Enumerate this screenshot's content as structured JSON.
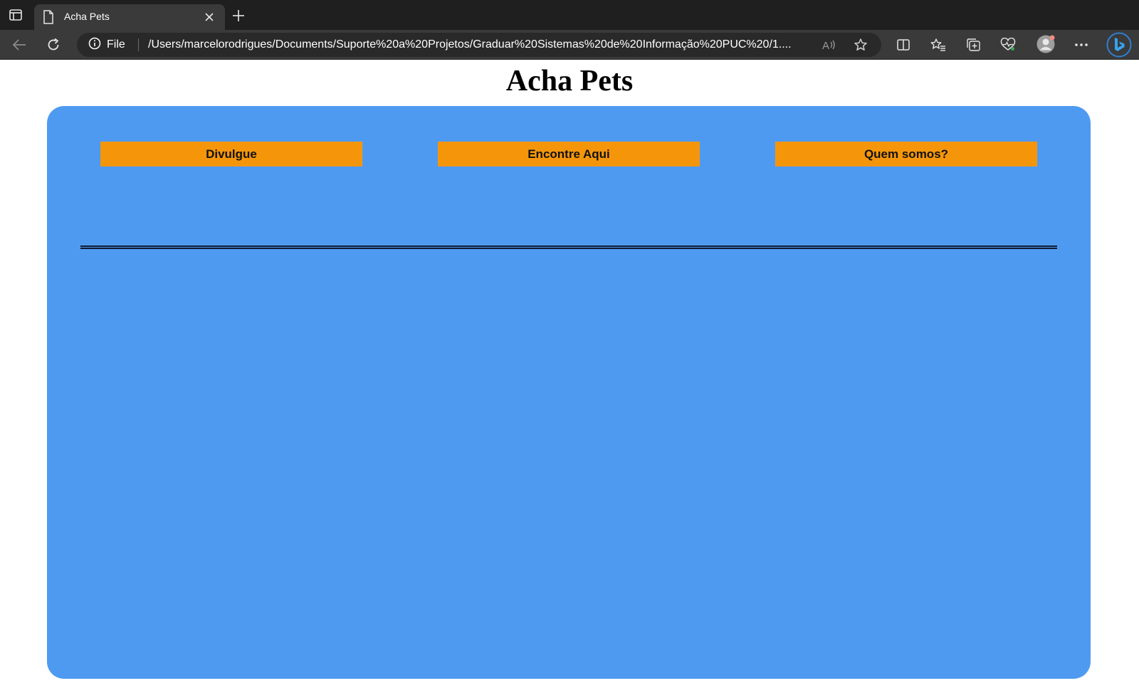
{
  "browser": {
    "tab": {
      "title": "Acha Pets"
    },
    "address_bar": {
      "site_info_label": "File",
      "url": "/Users/marcelorodrigues/Documents/Suporte%20a%20Projetos/Graduar%20Sistemas%20de%20Informação%20PUC%20/1...."
    },
    "icons": {
      "tab_actions": "tab-actions-icon",
      "tab_page": "document-icon",
      "tab_close": "close-icon",
      "new_tab": "plus-icon",
      "back": "back-arrow-icon",
      "reload": "reload-icon",
      "site_info": "info-icon",
      "read_aloud": "read-aloud-icon",
      "favorite": "star-icon",
      "split_screen": "split-screen-icon",
      "favorites": "favorites-icon",
      "collections": "collections-icon",
      "browser_essentials": "heartbeat-icon",
      "profile": "profile-avatar",
      "more": "more-icon",
      "copilot": "bing-icon"
    }
  },
  "page": {
    "title": "Acha Pets",
    "nav": {
      "divulgue": "Divulgue",
      "encontre": "Encontre Aqui",
      "quem_somos": "Quem somos?"
    }
  },
  "colors": {
    "panel": "#4f9af1",
    "button": "#f5960a",
    "tabbar": "#1f1f1f",
    "toolbar": "#3a3a3a"
  }
}
